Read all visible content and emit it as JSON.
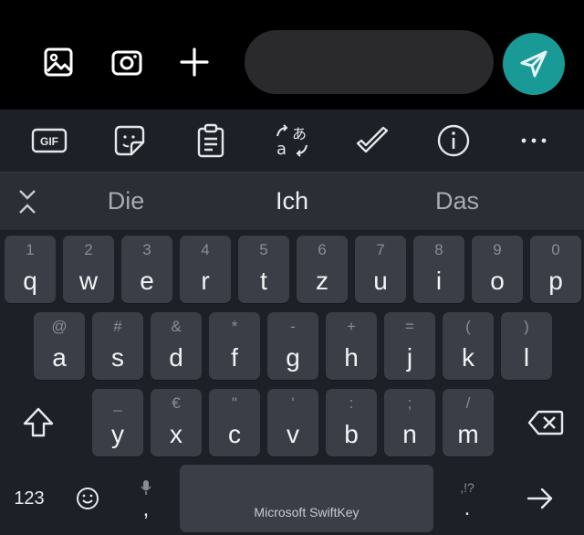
{
  "compose": {
    "message_placeholder": "",
    "icons": [
      "gallery-icon",
      "camera-icon",
      "plus-icon",
      "send-icon"
    ],
    "send_color": "#1a9a96"
  },
  "toolbar": {
    "gif_label": "GIF",
    "items": [
      "gif-icon",
      "sticker-icon",
      "clipboard-icon",
      "translate-icon",
      "check-icon",
      "info-icon",
      "more-icon"
    ]
  },
  "suggestions": [
    "Die",
    "Ich",
    "Das"
  ],
  "rows": [
    [
      {
        "hint": "1",
        "ch": "q"
      },
      {
        "hint": "2",
        "ch": "w"
      },
      {
        "hint": "3",
        "ch": "e"
      },
      {
        "hint": "4",
        "ch": "r"
      },
      {
        "hint": "5",
        "ch": "t"
      },
      {
        "hint": "6",
        "ch": "z"
      },
      {
        "hint": "7",
        "ch": "u"
      },
      {
        "hint": "8",
        "ch": "i"
      },
      {
        "hint": "9",
        "ch": "o"
      },
      {
        "hint": "0",
        "ch": "p"
      }
    ],
    [
      {
        "hint": "@",
        "ch": "a"
      },
      {
        "hint": "#",
        "ch": "s"
      },
      {
        "hint": "&",
        "ch": "d"
      },
      {
        "hint": "*",
        "ch": "f"
      },
      {
        "hint": "-",
        "ch": "g"
      },
      {
        "hint": "+",
        "ch": "h"
      },
      {
        "hint": "=",
        "ch": "j"
      },
      {
        "hint": "(",
        "ch": "k"
      },
      {
        "hint": ")",
        "ch": "l"
      }
    ],
    [
      {
        "hint": "_",
        "ch": "y"
      },
      {
        "hint": "€",
        "ch": "x"
      },
      {
        "hint": "\"",
        "ch": "c"
      },
      {
        "hint": "'",
        "ch": "v"
      },
      {
        "hint": ":",
        "ch": "b"
      },
      {
        "hint": ";",
        "ch": "n"
      },
      {
        "hint": "/",
        "ch": "m"
      }
    ]
  ],
  "bottom": {
    "numbers_label": "123",
    "comma_label": ",",
    "space_label": "Microsoft SwiftKey",
    "punct_hint": ",!?",
    "period_label": "."
  }
}
